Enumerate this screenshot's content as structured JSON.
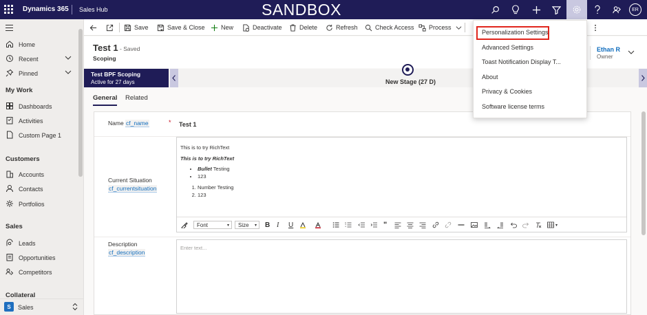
{
  "topbar": {
    "app_name": "Dynamics 365",
    "hub_name": "Sales Hub",
    "environment": "SANDBOX",
    "avatar_initials": "ER",
    "icons": [
      "search-icon",
      "lightbulb-icon",
      "plus-icon",
      "filter-icon",
      "gear-icon",
      "help-icon",
      "people-icon"
    ]
  },
  "sidebar": {
    "top_items": [
      {
        "label": "Home",
        "icon": "home-icon"
      },
      {
        "label": "Recent",
        "icon": "clock-icon"
      },
      {
        "label": "Pinned",
        "icon": "pin-icon"
      }
    ],
    "groups": [
      {
        "title": "My Work",
        "items": [
          {
            "label": "Dashboards",
            "icon": "dashboard-icon"
          },
          {
            "label": "Activities",
            "icon": "activities-icon"
          },
          {
            "label": "Custom Page 1",
            "icon": "page-icon"
          }
        ]
      },
      {
        "title": "Customers",
        "items": [
          {
            "label": "Accounts",
            "icon": "accounts-icon"
          },
          {
            "label": "Contacts",
            "icon": "person-icon"
          },
          {
            "label": "Portfolios",
            "icon": "portfolio-icon"
          }
        ]
      },
      {
        "title": "Sales",
        "items": [
          {
            "label": "Leads",
            "icon": "leads-icon"
          },
          {
            "label": "Opportunities",
            "icon": "opportunity-icon"
          },
          {
            "label": "Competitors",
            "icon": "competitor-icon"
          }
        ]
      },
      {
        "title": "Collateral",
        "items": []
      }
    ],
    "area": {
      "initial": "S",
      "label": "Sales"
    }
  },
  "commands": {
    "save": "Save",
    "save_close": "Save & Close",
    "new": "New",
    "deactivate": "Deactivate",
    "delete": "Delete",
    "refresh": "Refresh",
    "check_access": "Check Access",
    "process": "Process"
  },
  "record": {
    "title": "Test 1",
    "saved_status": "- Saved",
    "entity": "Scoping",
    "owner_name": "Ethan R",
    "owner_label": "Owner"
  },
  "bpf": {
    "process_name": "Test BPF Scoping",
    "active_for": "Active for 27 days",
    "stage_label": "New Stage  (27 D)"
  },
  "tabs": [
    {
      "label": "General",
      "selected": true
    },
    {
      "label": "Related",
      "selected": false
    }
  ],
  "form": {
    "name": {
      "label": "Name",
      "schema": "cf_name",
      "required_mark": "*",
      "value": "Test 1"
    },
    "current_situation": {
      "label": "Current Situation",
      "schema": "cf_currentsituation",
      "content": {
        "line1": "This is to try RichText",
        "line2": "This is to try RichText",
        "bullets": [
          {
            "bold": "Bullet",
            "text": " Testing"
          },
          {
            "bold": "",
            "text": "123"
          }
        ],
        "numbered": [
          "Number Testing",
          "123"
        ]
      },
      "toolbar": {
        "font": "Font",
        "size": "Size"
      }
    },
    "description": {
      "label": "Description",
      "schema": "cf_description",
      "placeholder": "Enter text..."
    }
  },
  "settings_menu": {
    "items": [
      {
        "label": "Personalization Settings",
        "highlighted": true
      },
      {
        "label": "Advanced Settings"
      },
      {
        "label": "Toast Notification Display T..."
      },
      {
        "label": "About"
      },
      {
        "label": "Privacy & Cookies"
      },
      {
        "label": "Software license terms"
      }
    ]
  },
  "colors": {
    "nav_dark": "#1f1c57",
    "accent_light": "#c9c8e0",
    "highlight_red": "#e0241b",
    "link_blue": "#0f6cbd"
  }
}
